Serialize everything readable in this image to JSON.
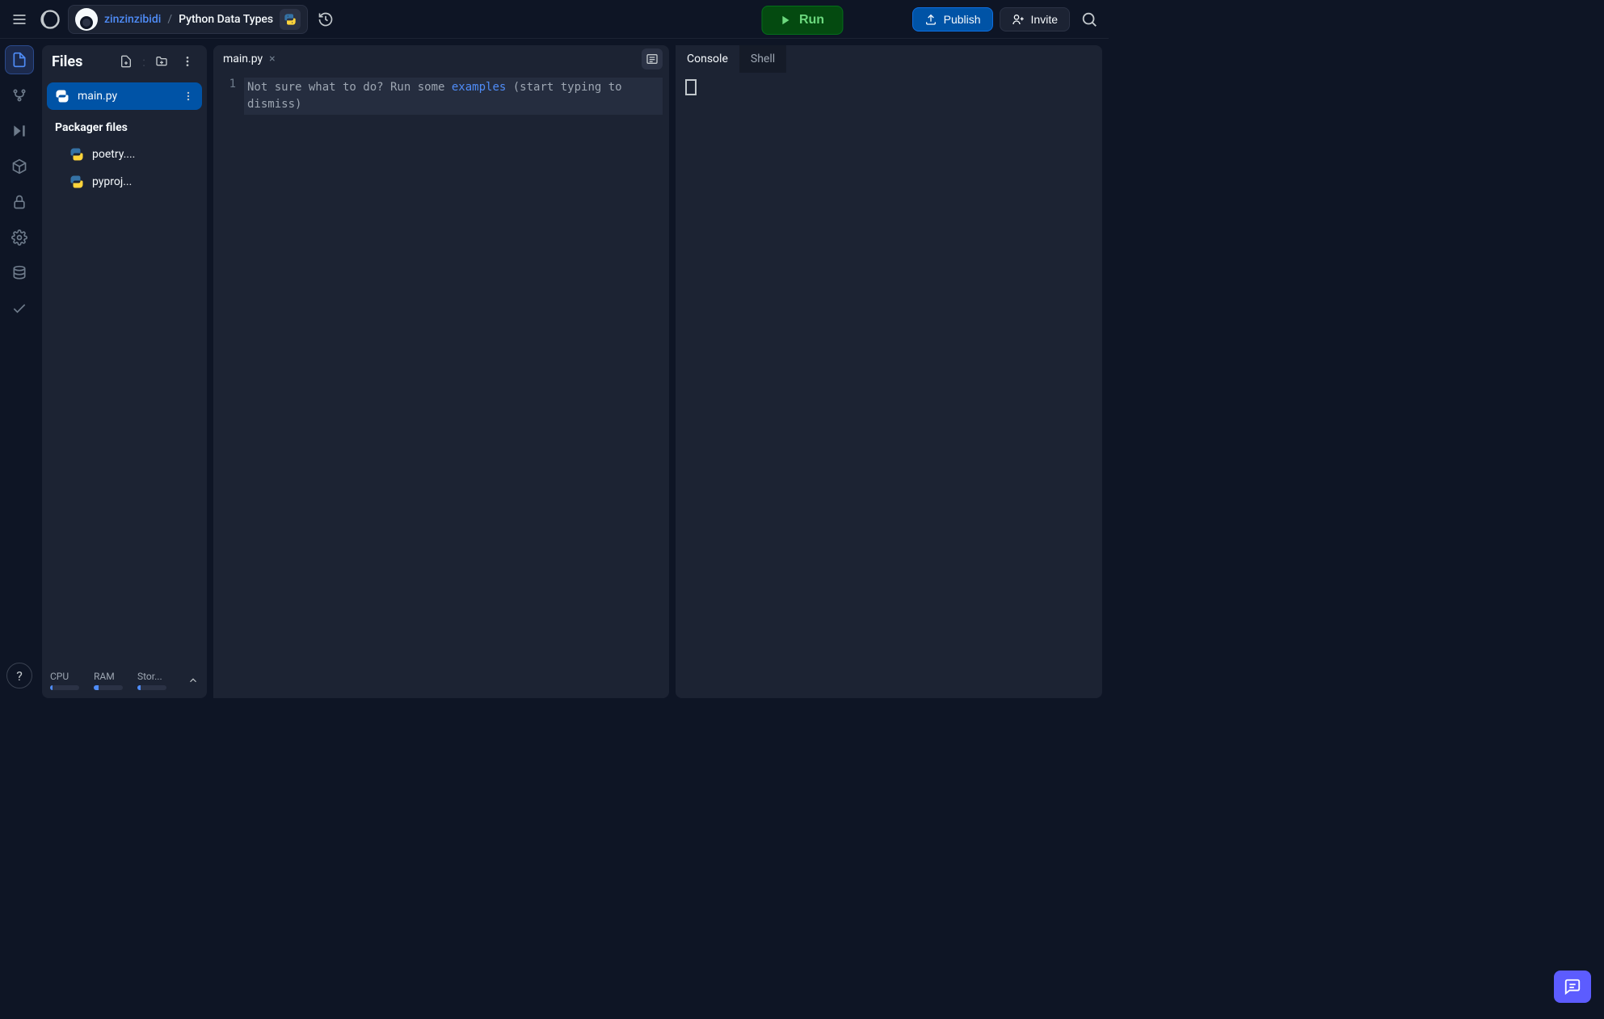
{
  "header": {
    "username": "zinzinzibidi",
    "separator": "/",
    "repl_name": "Python Data Types",
    "run_label": "Run",
    "publish_label": "Publish",
    "invite_label": "Invite"
  },
  "files_panel": {
    "title": "Files",
    "items": [
      {
        "name": "main.py",
        "selected": true
      }
    ],
    "section": "Packager files",
    "packager_items": [
      {
        "name": "poetry...."
      },
      {
        "name": "pyproj..."
      }
    ],
    "footer": {
      "cpu_label": "CPU",
      "ram_label": "RAM",
      "storage_label": "Stor...",
      "cpu_pct": 8,
      "ram_pct": 18,
      "storage_pct": 10
    }
  },
  "editor": {
    "tabs": [
      {
        "label": "main.py"
      }
    ],
    "line_number": "1",
    "hint_prefix": "Not sure what to do? Run some ",
    "hint_link": "examples",
    "hint_suffix": " (start typing to dismiss)"
  },
  "console": {
    "tab_console": "Console",
    "tab_shell": "Shell"
  }
}
